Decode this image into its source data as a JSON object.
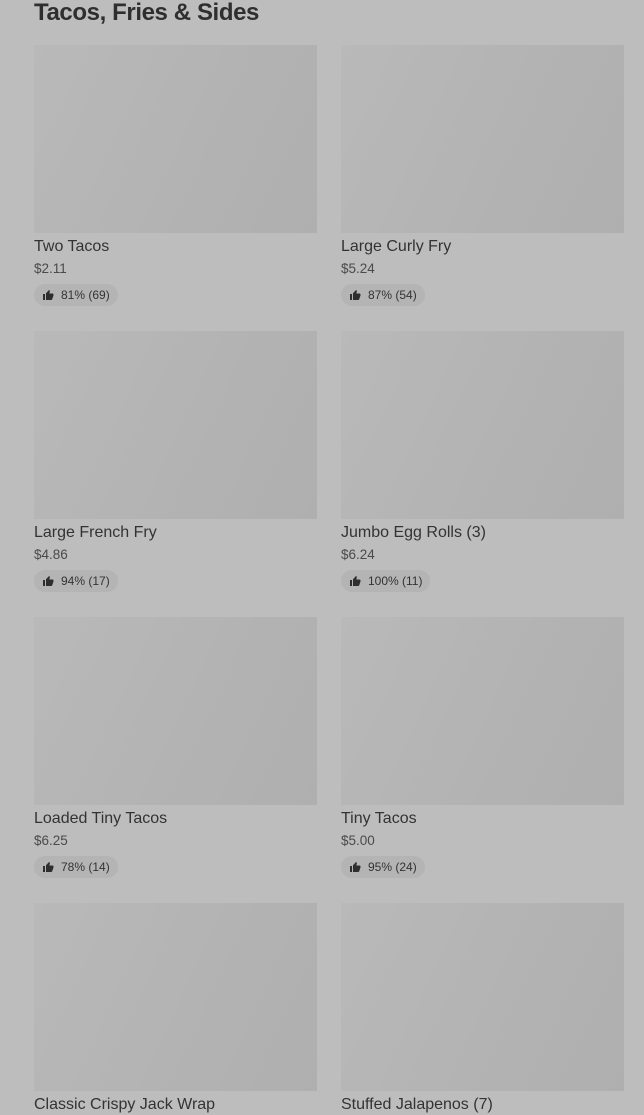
{
  "section": {
    "title": "Tacos, Fries & Sides"
  },
  "items": [
    {
      "name": "Two Tacos",
      "price": "$2.11",
      "rating": "81% (69)"
    },
    {
      "name": "Large Curly Fry",
      "price": "$5.24",
      "rating": "87% (54)"
    },
    {
      "name": "Large French Fry",
      "price": "$4.86",
      "rating": "94% (17)"
    },
    {
      "name": "Jumbo Egg Rolls (3)",
      "price": "$6.24",
      "rating": "100% (11)"
    },
    {
      "name": "Loaded Tiny Tacos",
      "price": "$6.25",
      "rating": "78% (14)"
    },
    {
      "name": "Tiny Tacos",
      "price": "$5.00",
      "rating": "95% (24)"
    },
    {
      "name": "Classic Crispy Jack Wrap"
    },
    {
      "name": "Stuffed Jalapenos (7)"
    }
  ],
  "icons": {
    "rating_icon": "thumbs-up-icon"
  },
  "colors": {
    "background": "#bdbdbd",
    "image_placeholder": "#b3b3b3",
    "rating_pill": "#b4b4b4",
    "text": "#333333"
  }
}
